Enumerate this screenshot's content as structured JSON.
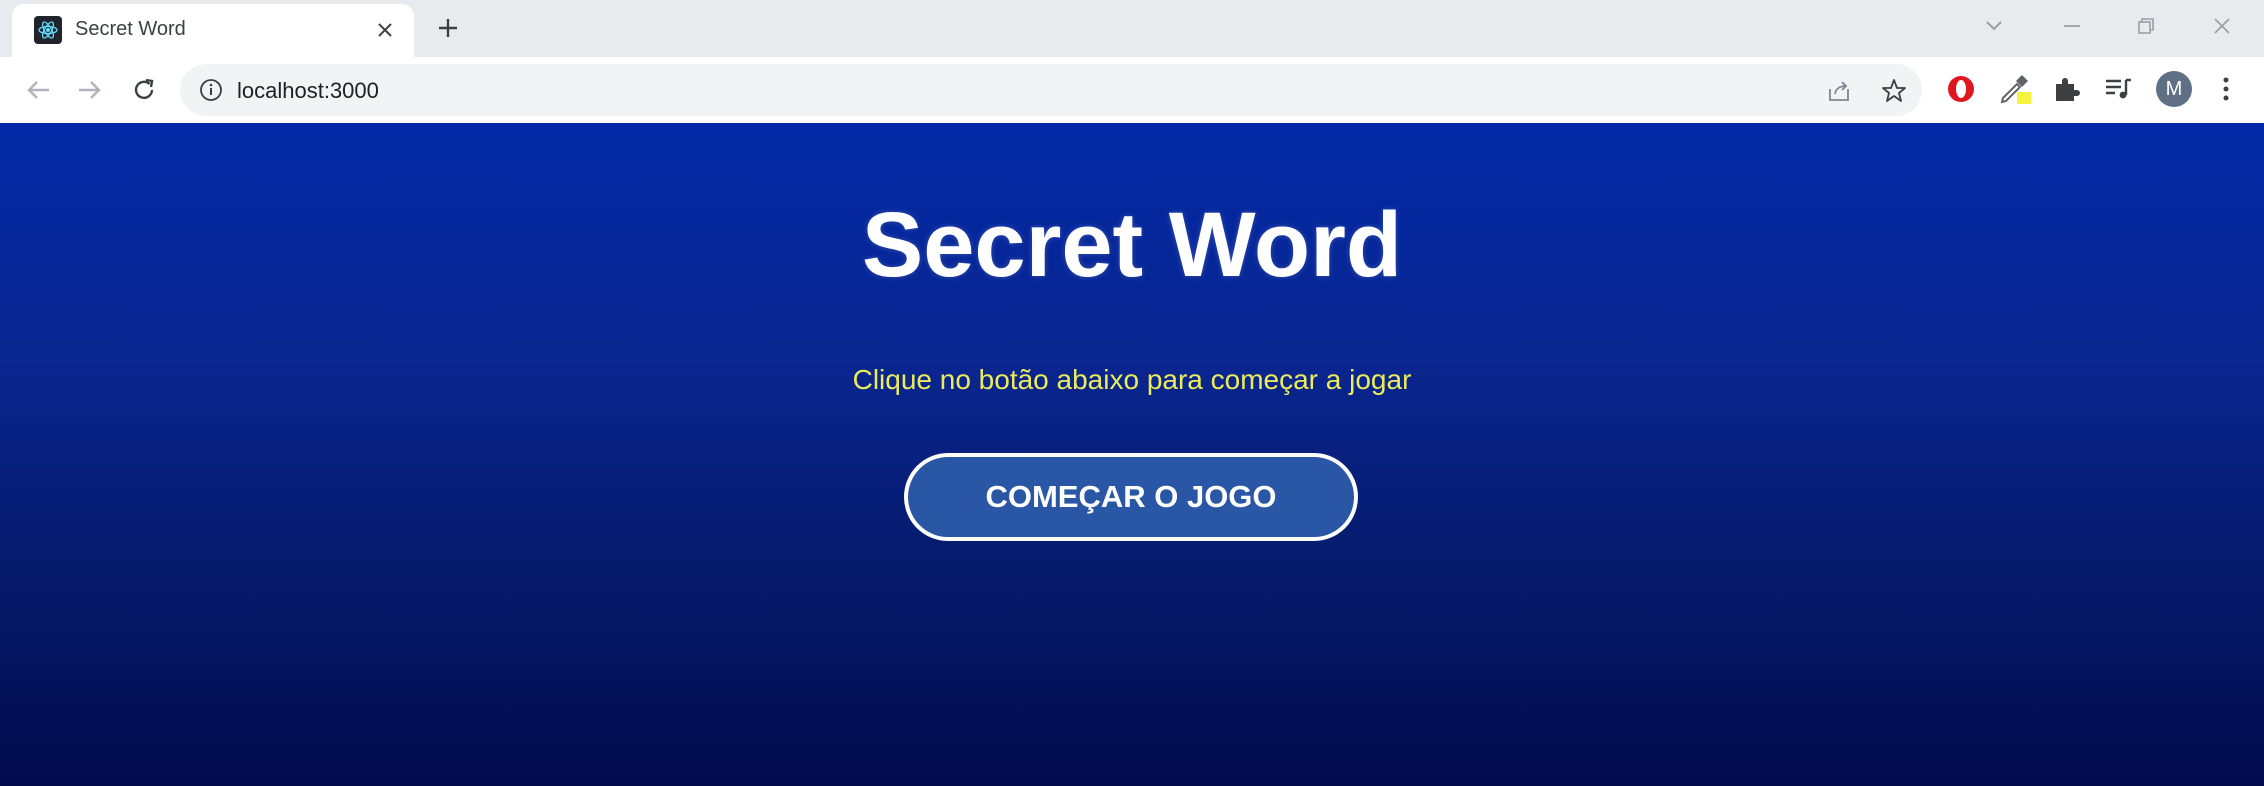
{
  "browser": {
    "tab": {
      "title": "Secret Word",
      "favicon": "react-logo-icon",
      "close_icon": "close-icon"
    },
    "new_tab_icon": "plus-icon",
    "window_controls": [
      "chevron-down-icon",
      "minimize-icon",
      "restore-icon",
      "close-icon"
    ],
    "nav": [
      "back-arrow-icon",
      "forward-arrow-icon",
      "reload-icon"
    ],
    "omnibox": {
      "url": "localhost:3000",
      "info_icon": "info-icon",
      "share_icon": "share-icon",
      "bookmark_icon": "star-icon"
    },
    "extensions": [
      "opera-icon",
      "eyedropper-icon",
      "puzzle-icon",
      "media-queue-icon"
    ],
    "profile_initial": "M",
    "menu_icon": "kebab-menu-icon"
  },
  "page": {
    "title": "Secret Word",
    "subtitle": "Clique no botão abaixo para começar a jogar",
    "start_button_label": "COMEÇAR O JOGO"
  },
  "colors": {
    "background_top": "#0128a6",
    "background_bottom": "#020b4c",
    "subtitle": "#ecec5a",
    "button_fill": "#2a56a6",
    "button_border": "#ffffff"
  }
}
